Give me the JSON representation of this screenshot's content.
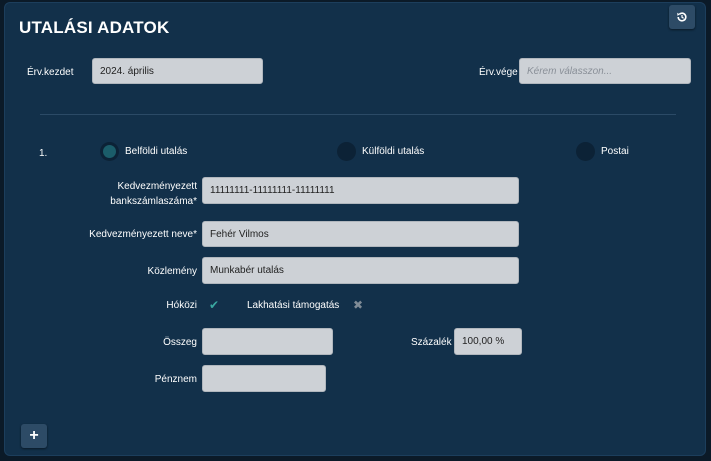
{
  "title": "UTALÁSI ADATOK",
  "icons": {
    "reset": "history-reset-icon",
    "add": "plus-icon",
    "check": "check-icon",
    "cross": "cross-icon"
  },
  "colors": {
    "panel": "#12304a",
    "input": "#cdd1d6",
    "radio_selected": "#1b5d6a",
    "check": "#3aa8a0",
    "cross": "#7f8b96"
  },
  "validity": {
    "start_label": "Érv.kezdet",
    "start_value": "2024. április",
    "end_label": "Érv.vége",
    "end_placeholder": "Kérem válasszon..."
  },
  "entry": {
    "index": "1.",
    "transfer_types": [
      {
        "label": "Belföldi utalás",
        "selected": true
      },
      {
        "label": "Külföldi utalás",
        "selected": false
      },
      {
        "label": "Postai",
        "selected": false
      }
    ],
    "account_label_1": "Kedvezményezett",
    "account_label_2": "bankszámlaszáma*",
    "account_value": "11111111-11111111-11111111",
    "name_label": "Kedvezményezett neve*",
    "name_value": "Fehér Vilmos",
    "note_label": "Közlemény",
    "note_value": "Munkabér utalás",
    "hokozi_label": "Hóközi",
    "hokozi_checked": true,
    "housing_label": "Lakhatási támogatás",
    "housing_checked": false,
    "amount_label": "Összeg",
    "amount_value": "",
    "percent_label": "Százalék",
    "percent_value": "100,00 %",
    "currency_label": "Pénznem",
    "currency_value": ""
  },
  "add_button": "+"
}
